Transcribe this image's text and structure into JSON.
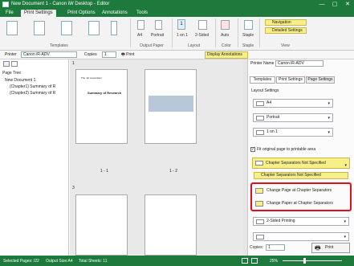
{
  "window": {
    "title": "New Document 1 - Canon iW Desktop - Editor",
    "minimize_glyph": "—",
    "maximize_glyph": "▢",
    "close_glyph": "✕"
  },
  "menu": {
    "tabs": [
      "File",
      "Print Settings",
      "Print Options",
      "Annotations",
      "Tools"
    ]
  },
  "ribbon": {
    "groups": {
      "templates": "Templates",
      "output_paper": "Output Paper",
      "layout": "Layout",
      "color": "Color",
      "staple": "Staple",
      "view": "View"
    },
    "a4_label": "A4",
    "portrait_label": "Portrait",
    "one_on_one_value": "1",
    "one_on_one_label": "1 on 1",
    "two_sided_label": "2-Sided",
    "auto_label": "Auto",
    "staple_label": "Staple",
    "navigation_label": "Navigation",
    "detailed_settings_label": "Detailed Settings"
  },
  "toolbar2": {
    "printer_label": "Printer",
    "printer_value": "Canon iR-ADV",
    "copies_label": "Copies",
    "copies_value": "1",
    "print_label": "Print",
    "display_annotations_label": "Display Annotations"
  },
  "left_pane": {
    "page_tree_label": "Page Tree",
    "items": [
      "New Document 1",
      "(Chapter1) Summary of R",
      "(Chapter2) Summary of R"
    ]
  },
  "pages": {
    "page1_number": "1",
    "page3_number": "3",
    "caption_1_1": "1 - 1",
    "caption_1_2": "1 - 2",
    "doc_title": "Summary of Research",
    "doc_company": "The .ltd corporation"
  },
  "right_pane": {
    "printer_name_label": "Printer Name",
    "printer_name_value": "Canon iR-ADV",
    "tabs": [
      "Templates",
      "Print Settings",
      "Page Settings"
    ],
    "layout_settings_label": "Layout Settings",
    "dd_a4": "A4",
    "dd_portrait": "Portrait",
    "dd_one_on_one": "1 on 1",
    "fit_label": "Fit original page to printable area",
    "chapter_sep_selected": "Chapter Separators Not Specified",
    "options": [
      "Chapter Separators Not Specified",
      "Change Page at Chapter Separators",
      "Change Paper at Chapter Separators"
    ],
    "two_sided_printing": "2-Sided Printing",
    "copies_label": "Copies:",
    "copies_value": "1",
    "print_button": "Print"
  },
  "status": {
    "selected_pages": "Selected Pages: /22",
    "output_size": "Output Size:A4",
    "total_sheets": "Total Sheets: 11",
    "zoom": "25%"
  },
  "colors": {
    "title_green": "#1e7a3c",
    "highlight_yellow": "#f7f08a",
    "callout_red": "#e0101a"
  }
}
